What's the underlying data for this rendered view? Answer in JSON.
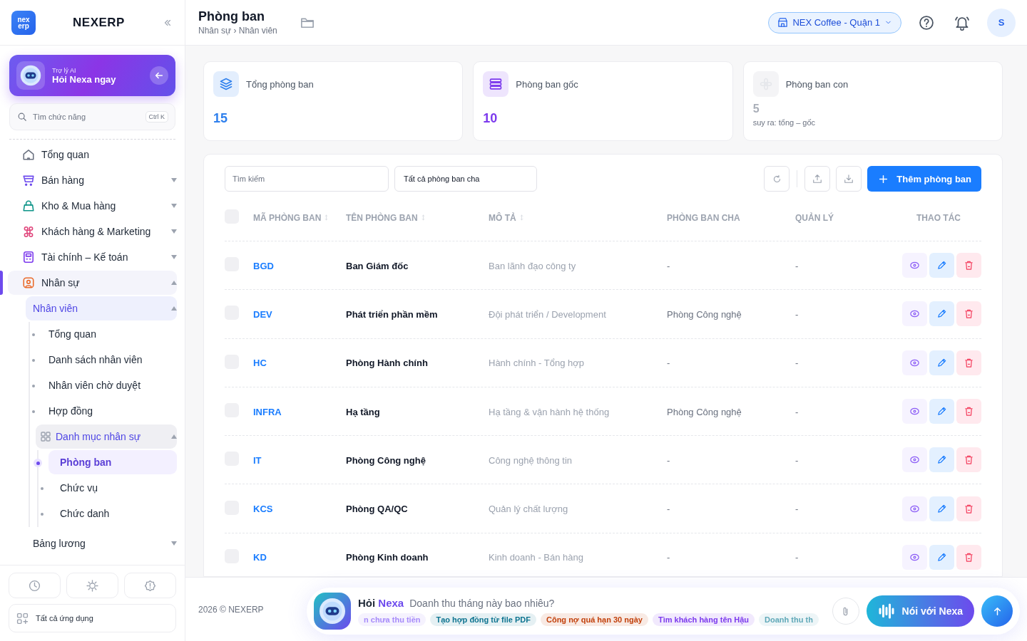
{
  "brand": {
    "logo": [
      "nex",
      "erp"
    ],
    "name": "NEXERP"
  },
  "ai_promo": {
    "caption": "Trợ lý AI",
    "title": "Hỏi Nexa ngay"
  },
  "function_search": {
    "placeholder": "Tìm chức năng",
    "shortcut": "Ctrl K"
  },
  "nav": [
    {
      "label": "Tổng quan",
      "kind": "home",
      "selected": false
    },
    {
      "label": "Bán hàng",
      "kind": "cart",
      "selected": false,
      "expanded": false
    },
    {
      "label": "Kho & Mua hàng",
      "kind": "bag",
      "selected": false,
      "expanded": false
    },
    {
      "label": "Khách hàng & Marketing",
      "kind": "people",
      "selected": false,
      "expanded": false
    },
    {
      "label": "Tài chính – Kế toán",
      "kind": "calc",
      "selected": false,
      "expanded": false
    },
    {
      "label": "Nhân sự",
      "kind": "person",
      "selected": false,
      "expanded": true,
      "children": [
        {
          "label": "Nhân viên",
          "selected": false,
          "expanded": true,
          "children": [
            {
              "label": "Tổng quan",
              "selected": false
            },
            {
              "label": "Danh sách nhân viên",
              "selected": false
            },
            {
              "label": "Nhân viên chờ duyệt",
              "selected": false
            },
            {
              "label": "Hợp đồng",
              "selected": false
            },
            {
              "label": "Danh mục nhân sự",
              "kind": "grid",
              "selected": false,
              "expanded": true,
              "children": [
                {
                  "label": "Phòng ban",
                  "selected": true
                },
                {
                  "label": "Chức vụ",
                  "selected": false
                },
                {
                  "label": "Chức danh",
                  "selected": false
                }
              ]
            }
          ]
        },
        {
          "label": "Bảng lương",
          "selected": false,
          "expanded": false
        }
      ]
    }
  ],
  "all_apps": "Tất cả ứng dụng",
  "header": {
    "title": "Phòng ban",
    "breadcrumb": "Nhân sự › Nhân viên",
    "store": "NEX Coffee - Quận 1",
    "avatar": "S"
  },
  "stats": [
    {
      "label": "Tổng phòng ban",
      "value": "15",
      "kind": "layers",
      "color": "#2f80ed"
    },
    {
      "label": "Phòng ban gốc",
      "value": "10",
      "kind": "list",
      "color": "#7c3aed"
    },
    {
      "label": "Phòng ban con",
      "value": "5",
      "note": "suy ra: tổng – gốc",
      "kind": "flower",
      "color": "#a9aeb8"
    }
  ],
  "toolbar": {
    "search_placeholder": "Tìm kiếm",
    "parent_filter": "Tất cả phòng ban cha",
    "add_button": "Thêm phòng ban"
  },
  "table": {
    "all_checked": false,
    "columns": [
      {
        "label": "MÃ PHÒNG BAN",
        "sortable": true
      },
      {
        "label": "TÊN PHÒNG BAN",
        "sortable": true
      },
      {
        "label": "MÔ TẢ",
        "sortable": true
      },
      {
        "label": "PHÒNG BAN CHA",
        "sortable": false
      },
      {
        "label": "QUẢN LÝ",
        "sortable": false
      },
      {
        "label": "THAO TÁC",
        "sortable": false
      }
    ],
    "rows": [
      {
        "checked": false,
        "code": "BGD",
        "name": "Ban Giám đốc",
        "description": "Ban lãnh đạo công ty",
        "parent": "-",
        "manager": "-"
      },
      {
        "checked": false,
        "code": "DEV",
        "name": "Phát triển phần mềm",
        "description": "Đội phát triển / Development",
        "parent": "Phòng Công nghệ",
        "manager": "-"
      },
      {
        "checked": false,
        "code": "HC",
        "name": "Phòng Hành chính",
        "description": "Hành chính - Tổng hợp",
        "parent": "-",
        "manager": "-"
      },
      {
        "checked": false,
        "code": "INFRA",
        "name": "Hạ tầng",
        "description": "Hạ tầng & vận hành hệ thống",
        "parent": "Phòng Công nghệ",
        "manager": "-"
      },
      {
        "checked": false,
        "code": "IT",
        "name": "Phòng Công nghệ",
        "description": "Công nghệ thông tin",
        "parent": "-",
        "manager": "-"
      },
      {
        "checked": false,
        "code": "KCS",
        "name": "Phòng QA/QC",
        "description": "Quản lý chất lượng",
        "parent": "-",
        "manager": "-"
      },
      {
        "checked": false,
        "code": "KD",
        "name": "Phòng Kinh doanh",
        "description": "Kinh doanh - Bán hàng",
        "parent": "-",
        "manager": "-"
      }
    ]
  },
  "footer": {
    "copyright": "2026 © NEXERP"
  },
  "ask_bar": {
    "title": "Hỏi",
    "name": "Nexa",
    "prompt": "Doanh thu tháng này bao nhiêu?",
    "voice_button": "Nói với Nexa",
    "suggestions": [
      {
        "label": "n chưa thu tiền",
        "color": "#a78bfa"
      },
      {
        "label": "Tạo hợp đồng từ file PDF",
        "color": "#0e7490"
      },
      {
        "label": "Công nợ quá hạn 30 ngày",
        "color": "#c2410c"
      },
      {
        "label": "Tìm khách hàng tên Hậu",
        "color": "#7c3aed"
      },
      {
        "label": "Doanh thu th",
        "color": "#5fa8b8"
      }
    ]
  }
}
